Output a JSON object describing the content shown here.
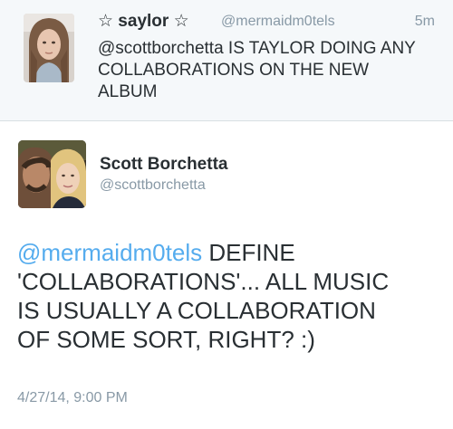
{
  "parent_tweet": {
    "display_name": "☆ saylor ☆",
    "handle": "@mermaidm0tels",
    "timestamp": "5m",
    "text_lines": [
      "@scottborchetta IS TAYLOR DOING ANY",
      "COLLABORATIONS ON THE NEW",
      "ALBUM"
    ]
  },
  "main_tweet": {
    "display_name": "Scott Borchetta",
    "handle": "@scottborchetta",
    "mention": "@mermaidm0tels",
    "text_lines": [
      " DEFINE",
      "'COLLABORATIONS'... ALL MUSIC",
      "IS USUALLY A COLLABORATION",
      "OF SOME SORT, RIGHT?  :)"
    ],
    "date": "4/27/14, 9:00 PM"
  },
  "colors": {
    "link": "#55acee",
    "text": "#292f33",
    "muted": "#8899a6",
    "parent_background": "#f5f8fa"
  }
}
